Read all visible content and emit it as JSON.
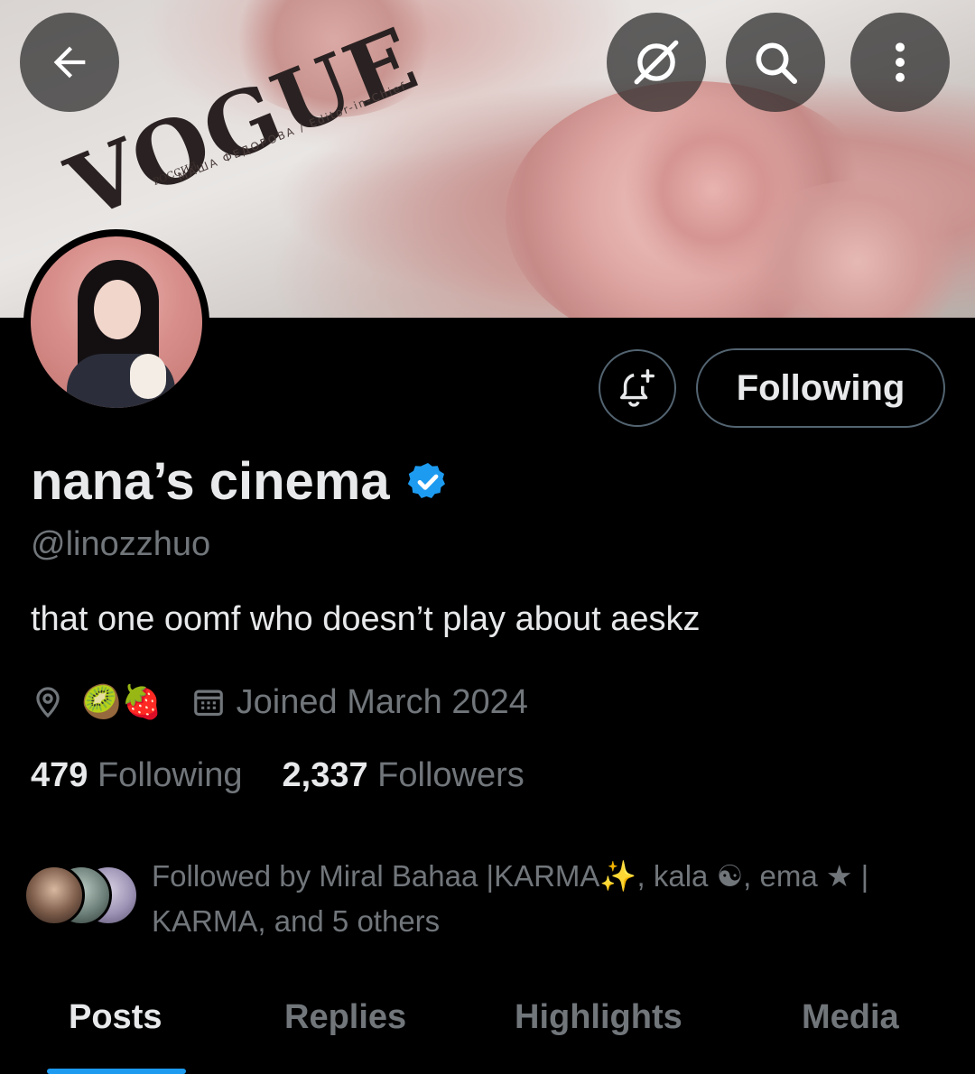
{
  "header": {
    "back_icon": "arrow-left-icon",
    "actions": [
      "grok-icon",
      "search-icon",
      "more-vertical-icon"
    ]
  },
  "banner": {
    "magazine_title": "VOGUE",
    "magazine_small": "РОССИЯ",
    "magazine_line": "МАША ФЕДОРОВА / Editor-in-Chief"
  },
  "profile": {
    "display_name": "nana’s cinema",
    "verified": true,
    "handle": "@linozzhuo",
    "bio": "that one oomf who doesn’t play about aeskz",
    "location_emoji": "🥝🍓",
    "joined": "Joined March 2024",
    "following_count": "479",
    "following_label": "Following",
    "followers_count": "2,337",
    "followers_label": "Followers"
  },
  "actions": {
    "notify_icon": "bell-plus-icon",
    "following_button": "Following"
  },
  "followed_by": {
    "text": "Followed by Miral Bahaa |KARMA✨, kala ☯, ema ★ | KARMA, and 5 others"
  },
  "tabs": [
    {
      "label": "Posts",
      "active": true
    },
    {
      "label": "Replies",
      "active": false
    },
    {
      "label": "Highlights",
      "active": false
    },
    {
      "label": "Media",
      "active": false
    }
  ],
  "colors": {
    "background": "#000000",
    "primary_text": "#e7e9ea",
    "secondary_text": "#71767b",
    "accent": "#1d9bf0",
    "border": "#536471"
  }
}
